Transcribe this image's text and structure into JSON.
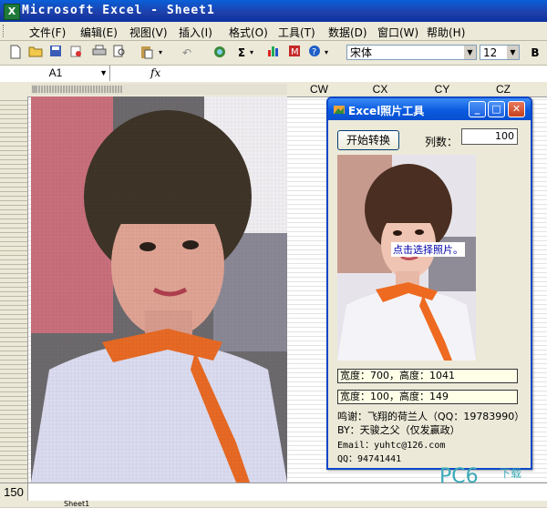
{
  "window": {
    "title": "Microsoft Excel - Sheet1"
  },
  "menu": [
    "文件(F)",
    "编辑(E)",
    "视图(V)",
    "插入(I)",
    "格式(O)",
    "工具(T)",
    "数据(D)",
    "窗口(W)",
    "帮助(H)"
  ],
  "toolbar": {
    "font_name": "宋体",
    "font_size": "12",
    "bold": "B",
    "sum": "Σ"
  },
  "formula_bar": {
    "cell_ref": "A1",
    "fx": "fx"
  },
  "sheet": {
    "column_headers": [
      "CW",
      "CX",
      "CY",
      "CZ"
    ],
    "row_number": "150",
    "tab_label": "Sheet1"
  },
  "dialog": {
    "title": "Excel照片工具",
    "convert_button": "开始转换",
    "columns_label": "列数：",
    "columns_value": "100",
    "photo_hint": "点击选择照片。",
    "original_size": "宽度：700，高度：1041",
    "new_size": "宽度：100，高度：149",
    "thanks": "鸣谢：飞翔的荷兰人（QQ：19783990）",
    "by": "BY：天骏之父（仅发赢政）",
    "email": "Email：yuhtc@126.com",
    "qq": "QQ：94741441"
  },
  "watermark": {
    "text": "PC6",
    "suffix": "下载"
  }
}
